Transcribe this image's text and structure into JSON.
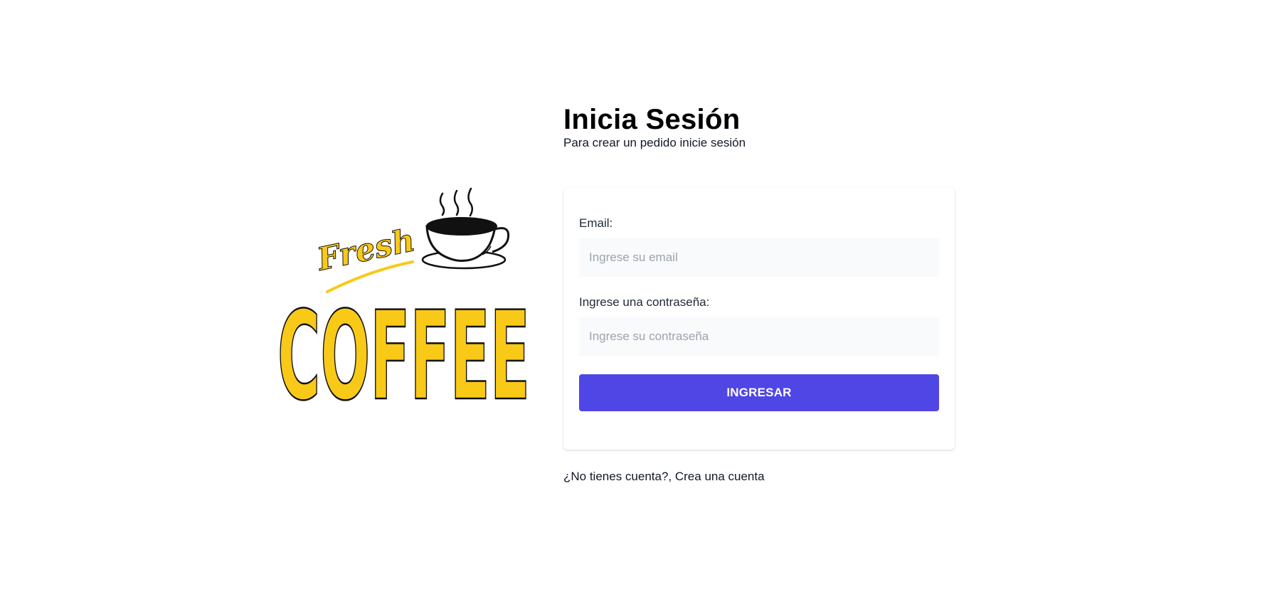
{
  "logo": {
    "icon": "fresh-coffee-logo",
    "script_text": "Fresh",
    "main_text": "COFFEE",
    "brand_color": "#f9c918"
  },
  "header": {
    "title": "Inicia Sesión",
    "subtitle": "Para crear un pedido inicie sesión"
  },
  "form": {
    "email_label": "Email:",
    "email_placeholder": "Ingrese su email",
    "email_value": "",
    "password_label": "Ingrese una contraseña:",
    "password_placeholder": "Ingrese su contraseña",
    "password_value": "",
    "submit_label": "INGRESAR"
  },
  "footer": {
    "register_link": "¿No tienes cuenta?, Crea una cuenta"
  },
  "colors": {
    "accent": "#4f46e5",
    "input_bg": "#f9fafb",
    "placeholder": "#9ca3af"
  }
}
